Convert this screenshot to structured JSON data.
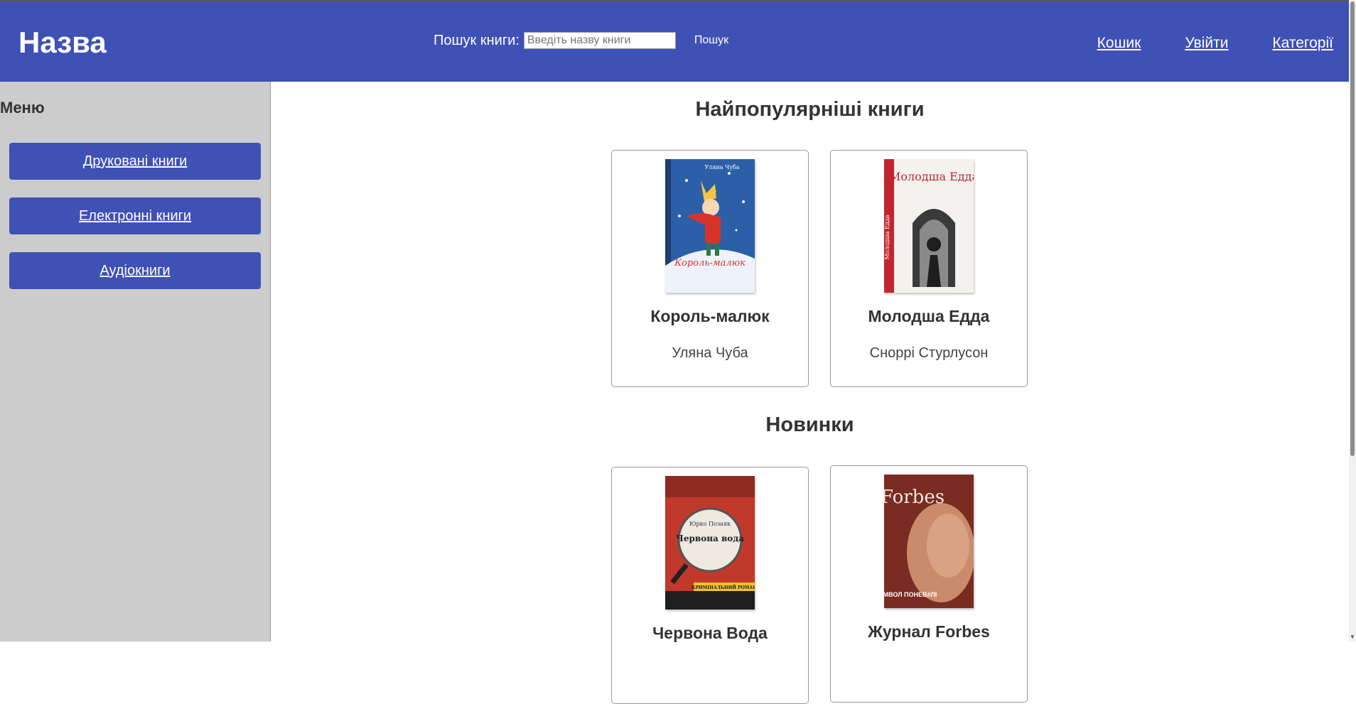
{
  "header": {
    "logo": "Назва",
    "search_label": "Пошук книги:",
    "search_placeholder": "Введіть назву книги",
    "search_button": "Пошук",
    "nav": [
      "Кошик",
      "Увійти",
      "Категорії"
    ]
  },
  "sidebar": {
    "title": "Меню",
    "items": [
      {
        "label": "Друковані книги"
      },
      {
        "label": "Електронні книги"
      },
      {
        "label": "Аудіокниги"
      }
    ]
  },
  "sections": [
    {
      "title": "Найпопулярніші книги",
      "books": [
        {
          "title": "Король-малюк",
          "author": "Уляна Чуба",
          "cover_author": "Уляна Чуба",
          "cover_title": "Король-малюк"
        },
        {
          "title": "Молодша Едда",
          "author": "Сноррі Стурлусон",
          "cover_title": "Молодша Едда",
          "cover_spine": "Молодша Едда"
        }
      ]
    },
    {
      "title": "Новинки",
      "books": [
        {
          "title": "Червона Вода",
          "author": "",
          "cover_author": "Юрко Позаяк",
          "cover_title": "Червона вода",
          "cover_strip": "КРИМІНАЛЬНИЙ РОМАН"
        },
        {
          "title": "Журнал Forbes",
          "author": "",
          "cover_title": "Forbes",
          "cover_headline": "СИМВОЛ ПОНЕВ#ЛІ"
        }
      ]
    }
  ],
  "colors": {
    "header_bg": "#3f51b5",
    "sidebar_bg": "#cccccc",
    "button_bg": "#3f51b5"
  }
}
